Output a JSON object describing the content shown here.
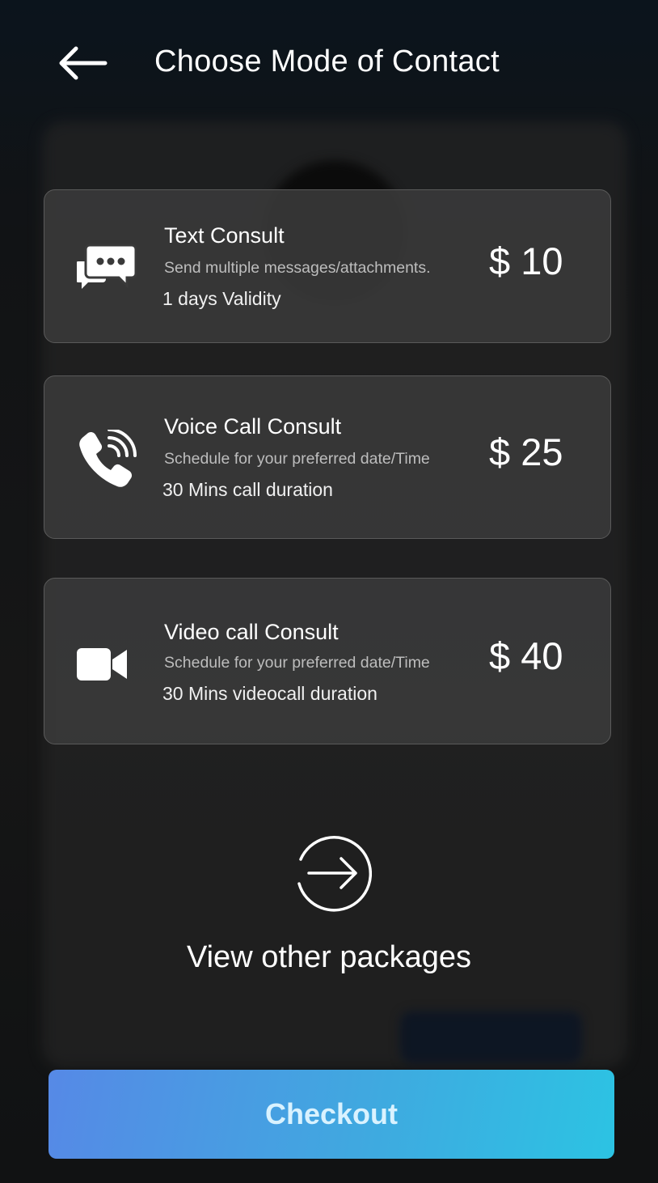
{
  "header": {
    "title": "Choose Mode of Contact"
  },
  "options": [
    {
      "name": "Text Consult",
      "description": "Send multiple messages/attachments.",
      "meta": "1 days Validity",
      "price": "$ 10",
      "icon": "chat-icon"
    },
    {
      "name": "Voice Call Consult",
      "description": "Schedule for your preferred date/Time",
      "meta": "30 Mins call duration",
      "price": "$ 25",
      "icon": "phone-call-icon"
    },
    {
      "name": "Video call Consult",
      "description": "Schedule for your preferred date/Time",
      "meta": "30 Mins videocall duration",
      "price": "$ 40",
      "icon": "video-camera-icon"
    }
  ],
  "view_other": {
    "label": "View other packages",
    "icon": "arrow-right-circle-icon"
  },
  "checkout": {
    "label": "Checkout"
  },
  "colors": {
    "checkout_gradient_start": "#5689e6",
    "checkout_gradient_end": "#2cc3e3",
    "card_background": "#3a3a3a"
  }
}
